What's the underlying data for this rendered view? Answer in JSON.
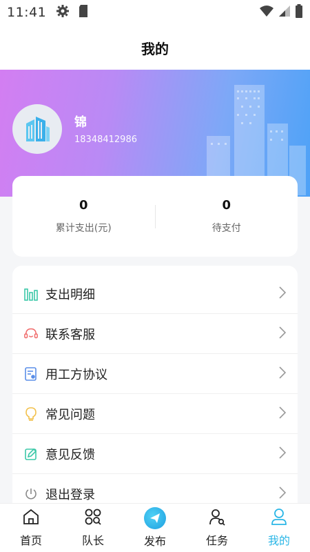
{
  "status_bar": {
    "time": "11:41"
  },
  "nav": {
    "title": "我的"
  },
  "profile": {
    "name": "锦",
    "phone": "18348412986"
  },
  "stats": [
    {
      "value": "0",
      "label": "累计支出(元)"
    },
    {
      "value": "0",
      "label": "待支付"
    }
  ],
  "menu": [
    {
      "label": "支出明细",
      "icon": "bar-chart-icon"
    },
    {
      "label": "联系客服",
      "icon": "headset-icon"
    },
    {
      "label": "用工方协议",
      "icon": "contract-icon"
    },
    {
      "label": "常见问题",
      "icon": "lightbulb-icon"
    },
    {
      "label": "意见反馈",
      "icon": "edit-icon"
    },
    {
      "label": "退出登录",
      "icon": "power-icon"
    }
  ],
  "tabs": [
    {
      "label": "首页",
      "icon": "home-icon"
    },
    {
      "label": "队长",
      "icon": "team-icon"
    },
    {
      "label": "发布",
      "icon": "publish-icon"
    },
    {
      "label": "任务",
      "icon": "task-search-icon"
    },
    {
      "label": "我的",
      "icon": "user-icon"
    }
  ],
  "colors": {
    "active_tab": "#2ab6e6",
    "banner_start": "#d37ef2",
    "banner_end": "#4da2f7"
  }
}
